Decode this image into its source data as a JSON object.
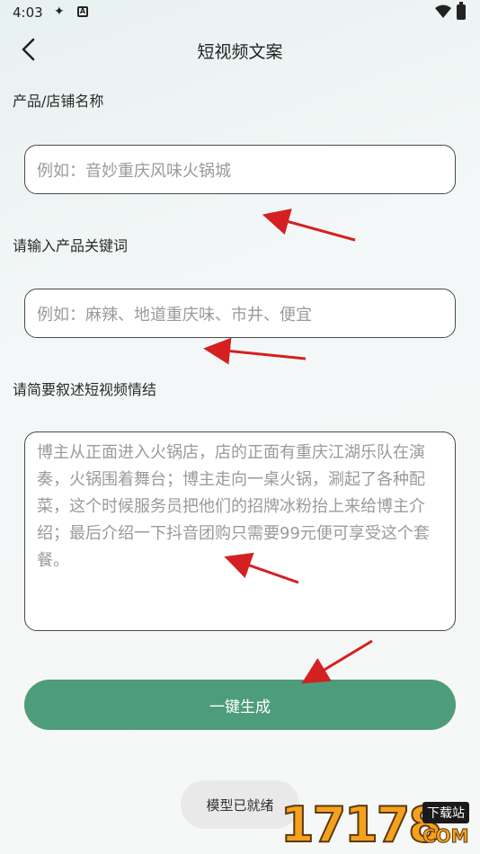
{
  "status_bar": {
    "time": "4:03",
    "icon_a": "✦",
    "icon_b": "A"
  },
  "header": {
    "title": "短视频文案"
  },
  "form": {
    "product_label": "产品/店铺名称",
    "product_placeholder": "例如：音妙重庆风味火锅城",
    "keywords_label": "请输入产品关键词",
    "keywords_placeholder": "例如：麻辣、地道重庆味、市井、便宜",
    "summary_label": "请简要叙述短视频情结",
    "summary_placeholder": "博主从正面进入火锅店，店的正面有重庆江湖乐队在演奏，火锅围着舞台；博主走向一桌火锅，涮起了各种配菜，这个时候服务员把他们的招牌冰粉抬上来给博主介绍；最后介绍一下抖音团购只需要99元便可享受这个套餐。",
    "generate_label": "一键生成"
  },
  "toast": {
    "text": "模型已就绪"
  },
  "watermark": {
    "digits": "17178",
    "tag": "下载站",
    "domain": "COM"
  },
  "colors": {
    "accent": "#4d9c7c",
    "arrow": "#d42020"
  }
}
